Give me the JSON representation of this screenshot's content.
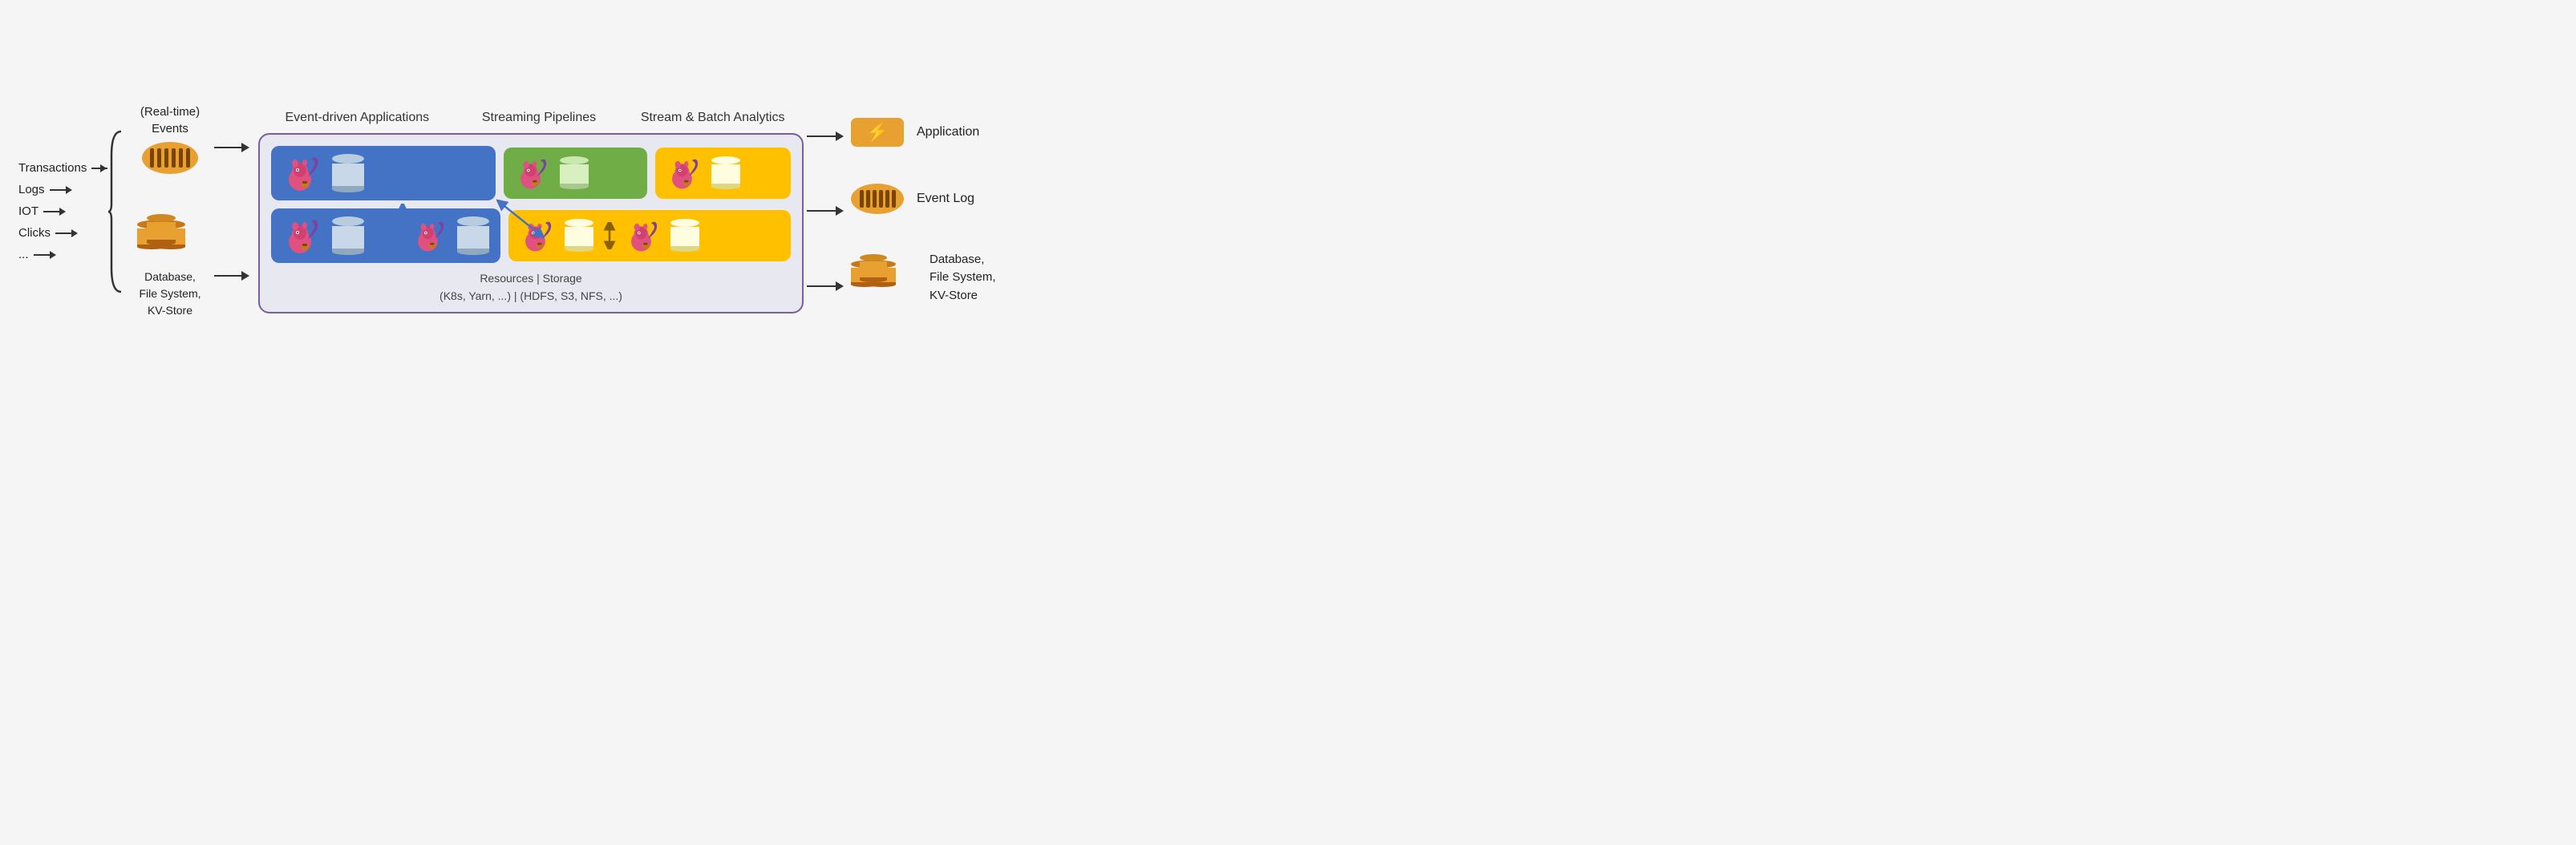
{
  "inputs": {
    "items": [
      {
        "label": "Transactions"
      },
      {
        "label": "Logs"
      },
      {
        "label": "IOT"
      },
      {
        "label": "Clicks"
      },
      {
        "label": "..."
      }
    ]
  },
  "events_section": {
    "title": "(Real-time)\nEvents",
    "db_label": "Database,\nFile System,\nKV-Store"
  },
  "column_headers": {
    "col1": "Event-driven\nApplications",
    "col2": "Streaming\nPipelines",
    "col3": "Stream & Batch\nAnalytics"
  },
  "box_footer": {
    "line1": "Resources | Storage",
    "line2": "(K8s, Yarn, ...) | (HDFS, S3, NFS, ...)"
  },
  "outputs": {
    "items": [
      {
        "label": "Application",
        "icon": "app"
      },
      {
        "label": "Event Log",
        "icon": "kafka"
      },
      {
        "label": "Database,\nFile System,\nKV-Store",
        "icon": "db"
      }
    ]
  },
  "colors": {
    "border_purple": "#7a5fa0",
    "panel_blue": "#4472C4",
    "panel_green": "#70AD47",
    "panel_yellow": "#FFC000",
    "orange": "#E8A030"
  }
}
